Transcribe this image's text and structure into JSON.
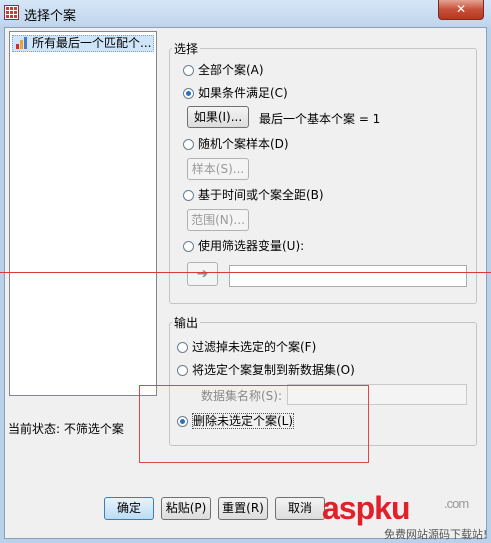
{
  "window": {
    "title": "选择个案",
    "close_glyph": "✕"
  },
  "variables": {
    "items": [
      {
        "label": "所有最后一个匹配个..."
      }
    ]
  },
  "status": {
    "text": "当前状态: 不筛选个案"
  },
  "select": {
    "legend": "选择",
    "options": {
      "all_cases": "全部个案(A)",
      "if_condition": "如果条件满足(C)",
      "random_sample": "随机个案样本(D)",
      "time_range": "基于时间或个案全距(B)",
      "filter_var": "使用筛选器变量(U):"
    },
    "selected": "if_condition",
    "if_button": "如果(I)...",
    "condition_text": "最后一个基本个案 = 1",
    "sample_button": "样本(S)...",
    "range_button": "范围(N)...",
    "arrow_glyph": "➔",
    "filter_value": ""
  },
  "output": {
    "legend": "输出",
    "options": {
      "filter_out": "过滤掉未选定的个案(F)",
      "copy_new": "将选定个案复制到新数据集(O)",
      "delete": "删除未选定个案(L)"
    },
    "selected": "delete",
    "dataset_label": "数据集名称(S):",
    "dataset_value": ""
  },
  "buttons": {
    "ok": "确定",
    "paste": "粘贴(P)",
    "reset": "重置(R)",
    "cancel": "取消"
  },
  "watermark": {
    "text": "aspku",
    "domain": ".com",
    "tagline": "免费网站源码下载站!"
  }
}
